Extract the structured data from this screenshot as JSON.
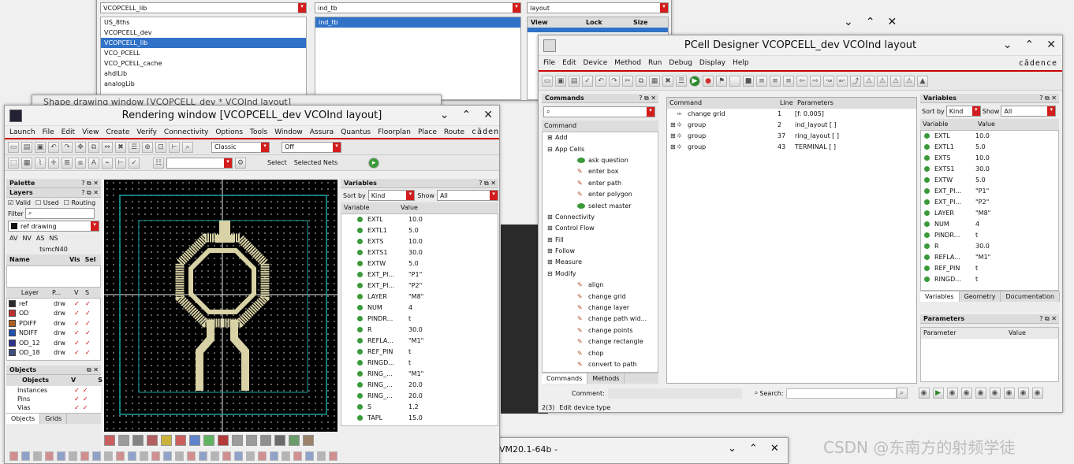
{
  "library_manager": {
    "lib_dropdown": "VCOPCELL_lib",
    "cell_dropdown": "ind_tb",
    "view_dropdown": "layout",
    "libraries": [
      "US_8ths",
      "VCOPCELL_dev",
      "VCOPCELL_lib",
      "VCO_PCELL",
      "VCO_PCELL_cache",
      "ahdlLib",
      "analogLib"
    ],
    "selected_library_index": 2,
    "cells": [
      "ind_tb"
    ],
    "view_columns": [
      "View",
      "Lock",
      "Size"
    ]
  },
  "bg_window": {
    "title": "Shape drawing window [VCOPCELL_dev * VCOInd layout]"
  },
  "rendering": {
    "title": "Rendering window [VCOPCELL_dev VCOInd layout]",
    "menus": [
      "Launch",
      "File",
      "Edit",
      "View",
      "Create",
      "Verify",
      "Connectivity",
      "Options",
      "Tools",
      "Window",
      "Assura",
      "Quantus",
      "Floorplan",
      "Place",
      "Route"
    ],
    "brand": "cādence",
    "classic_dropdown": "Classic",
    "off_dropdown": "Off",
    "select_label": "Select",
    "selected_nets_label": "Selected Nets",
    "palette": {
      "title": "Palette",
      "layers_title": "Layers",
      "filters": [
        "Valid",
        "Used",
        "Routing"
      ],
      "filter_label": "Filter",
      "ref_drawing": "ref drawing",
      "visibility": [
        "AV",
        "NV",
        "AS",
        "NS"
      ],
      "tech": "tsmcN40",
      "name_headers": [
        "Name",
        "Vis",
        "Sel"
      ],
      "layer_headers": [
        "Layer",
        "P...",
        "V",
        "S"
      ],
      "layers": [
        {
          "name": "ref",
          "purpose": "drw",
          "color": "#2a2a2a"
        },
        {
          "name": "OD",
          "purpose": "drw",
          "color": "#c03030"
        },
        {
          "name": "PDIFF",
          "purpose": "drw",
          "color": "#b06020"
        },
        {
          "name": "NDIFF",
          "purpose": "drw",
          "color": "#2050b0"
        },
        {
          "name": "OD_12",
          "purpose": "drw",
          "color": "#303090"
        },
        {
          "name": "OD_18",
          "purpose": "drw",
          "color": "#405080"
        }
      ],
      "objects_title": "Objects",
      "objects_headers": [
        "Objects",
        "V",
        "S"
      ],
      "objects": [
        "Instances",
        "Pins",
        "Vias"
      ],
      "tabs": [
        "Objects",
        "Grids"
      ]
    },
    "variables": {
      "title": "Variables",
      "sort_by_label": "Sort by",
      "sort_by_value": "Kind",
      "show_label": "Show",
      "show_value": "All",
      "col_variable": "Variable",
      "col_value": "Value",
      "rows": [
        {
          "name": "EXTL",
          "value": "10.0"
        },
        {
          "name": "EXTL1",
          "value": "5.0"
        },
        {
          "name": "EXTS",
          "value": "10.0"
        },
        {
          "name": "EXTS1",
          "value": "30.0"
        },
        {
          "name": "EXTW",
          "value": "5.0"
        },
        {
          "name": "EXT_PI...",
          "value": "\"P1\""
        },
        {
          "name": "EXT_PI...",
          "value": "\"P2\""
        },
        {
          "name": "LAYER",
          "value": "\"M8\""
        },
        {
          "name": "NUM",
          "value": "4"
        },
        {
          "name": "PINDR...",
          "value": "t"
        },
        {
          "name": "R",
          "value": "30.0"
        },
        {
          "name": "REFLA...",
          "value": "\"M1\""
        },
        {
          "name": "REF_PIN",
          "value": "t"
        },
        {
          "name": "RINGD...",
          "value": "t"
        },
        {
          "name": "RING_...",
          "value": "\"M1\""
        },
        {
          "name": "RING_...",
          "value": "20.0"
        },
        {
          "name": "RING_...",
          "value": "20.0"
        },
        {
          "name": "S",
          "value": "1.2"
        },
        {
          "name": "TAPL",
          "value": "15.0"
        }
      ]
    }
  },
  "pcell": {
    "title": "PCell Designer VCOPCELL_dev VCOInd layout",
    "menus": [
      "File",
      "Edit",
      "Device",
      "Method",
      "Run",
      "Debug",
      "Display",
      "Help"
    ],
    "brand": "cādence",
    "commands": {
      "title": "Commands",
      "header": "Command",
      "tree": [
        {
          "label": "Add",
          "level": 0,
          "exp": "+"
        },
        {
          "label": "App Cells",
          "level": 0,
          "exp": "-"
        },
        {
          "label": "ask question",
          "level": 1,
          "icon": "green"
        },
        {
          "label": "enter box",
          "level": 1,
          "icon": "edit"
        },
        {
          "label": "enter path",
          "level": 1,
          "icon": "edit"
        },
        {
          "label": "enter polygon",
          "level": 1,
          "icon": "edit"
        },
        {
          "label": "select master",
          "level": 1,
          "icon": "green"
        },
        {
          "label": "Connectivity",
          "level": 0,
          "exp": "+"
        },
        {
          "label": "Control Flow",
          "level": 0,
          "exp": "+"
        },
        {
          "label": "Fill",
          "level": 0,
          "exp": "+"
        },
        {
          "label": "Follow",
          "level": 0,
          "exp": "+"
        },
        {
          "label": "Measure",
          "level": 0,
          "exp": "+"
        },
        {
          "label": "Modify",
          "level": 0,
          "exp": "-"
        },
        {
          "label": "align",
          "level": 1,
          "icon": "edit"
        },
        {
          "label": "change grid",
          "level": 1,
          "icon": "edit"
        },
        {
          "label": "change layer",
          "level": 1,
          "icon": "edit"
        },
        {
          "label": "change path wid...",
          "level": 1,
          "icon": "edit"
        },
        {
          "label": "change points",
          "level": 1,
          "icon": "edit"
        },
        {
          "label": "change rectangle",
          "level": 1,
          "icon": "edit"
        },
        {
          "label": "chop",
          "level": 1,
          "icon": "edit"
        },
        {
          "label": "convert to path",
          "level": 1,
          "icon": "edit"
        }
      ],
      "tabs": [
        "Commands",
        "Methods"
      ]
    },
    "program": {
      "headers": [
        "Command",
        "Line",
        "Parameters"
      ],
      "rows": [
        {
          "cmd": "change grid",
          "line": "1",
          "params": "[f: 0.005]",
          "exp": ""
        },
        {
          "cmd": "group",
          "line": "2",
          "params": "ind_layout [ ]",
          "exp": "+"
        },
        {
          "cmd": "group",
          "line": "37",
          "params": "ring_layout [ ]",
          "exp": "+"
        },
        {
          "cmd": "group",
          "line": "43",
          "params": "TERMINAL [ ]",
          "exp": "+"
        }
      ],
      "comment_label": "Comment:",
      "search_label": "Search:"
    },
    "variables": {
      "title": "Variables",
      "sort_by_label": "Sort by",
      "sort_by_value": "Kind",
      "show_label": "Show",
      "show_value": "All",
      "col_variable": "Variable",
      "col_value": "Value",
      "rows": [
        {
          "name": "EXTL",
          "value": "10.0"
        },
        {
          "name": "EXTL1",
          "value": "5.0"
        },
        {
          "name": "EXTS",
          "value": "10.0"
        },
        {
          "name": "EXTS1",
          "value": "30.0"
        },
        {
          "name": "EXTW",
          "value": "5.0"
        },
        {
          "name": "EXT_PI...",
          "value": "\"P1\""
        },
        {
          "name": "EXT_PI...",
          "value": "\"P2\""
        },
        {
          "name": "LAYER",
          "value": "\"M8\""
        },
        {
          "name": "NUM",
          "value": "4"
        },
        {
          "name": "PINDR...",
          "value": "t"
        },
        {
          "name": "R",
          "value": "30.0"
        },
        {
          "name": "REFLA...",
          "value": "\"M1\""
        },
        {
          "name": "REF_PIN",
          "value": "t"
        },
        {
          "name": "RINGD...",
          "value": "t"
        }
      ],
      "tabs": [
        "Variables",
        "Geometry",
        "Documentation"
      ]
    },
    "parameters": {
      "title": "Parameters",
      "headers": [
        "Parameter",
        "Value"
      ]
    },
    "status": {
      "line": "2(3)",
      "text": "Edit device type"
    }
  },
  "bottom_window": {
    "title": "VM20.1-64b -"
  },
  "watermark": "CSDN @东南方的射频学徒"
}
